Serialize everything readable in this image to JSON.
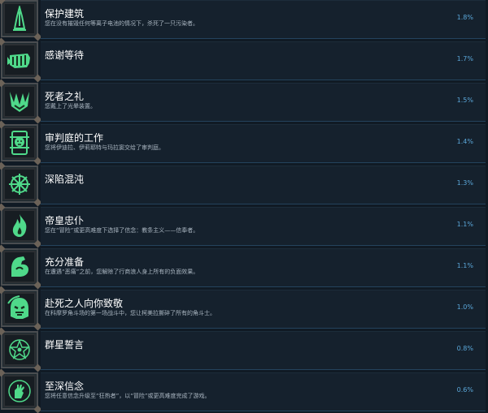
{
  "accent": "#5aa6d8",
  "icon_color": "#4fd98a",
  "achievements": [
    {
      "name": "保护建筑",
      "description": "您在没有摧毁任何等离子电池的情况下，杀死了一只污染者。",
      "percent": "1.8%",
      "icon": "spire-icon"
    },
    {
      "name": "感谢等待",
      "description": "",
      "percent": "1.7%",
      "icon": "gauntlet-icon"
    },
    {
      "name": "死者之礼",
      "description": "您戴上了光晕装置。",
      "percent": "1.5%",
      "icon": "halo-icon"
    },
    {
      "name": "审判庭的工作",
      "description": "您将伊迪拉、伊莉耶特与玛拉窦交给了审判庭。",
      "percent": "1.4%",
      "icon": "inquisition-icon"
    },
    {
      "name": "深陷混沌",
      "description": "",
      "percent": "1.3%",
      "icon": "chaos-star-icon"
    },
    {
      "name": "帝皇忠仆",
      "description": "您在“冒险”或更高难度下选择了信念：教条主义——信奉者。",
      "percent": "1.1%",
      "icon": "flame-icon"
    },
    {
      "name": "充分准备",
      "description": "在遭遇“恶痛”之前，您解除了行商浪人身上所有的负面效果。",
      "percent": "1.1%",
      "icon": "flexed-arm-icon"
    },
    {
      "name": "赴死之人向你致敬",
      "description": "在科摩罗角斗场的第一场战斗中，您让柯美拉撕碎了所有的角斗士。",
      "percent": "1.0%",
      "icon": "gladiator-helm-icon"
    },
    {
      "name": "群星誓言",
      "description": "",
      "percent": "0.8%",
      "icon": "star-oath-icon"
    },
    {
      "name": "至深信念",
      "description": "您将任意信念升级至“狂热者”，以“冒险”或更高难度完成了游戏。",
      "percent": "0.6%",
      "icon": "devout-hand-icon"
    }
  ]
}
